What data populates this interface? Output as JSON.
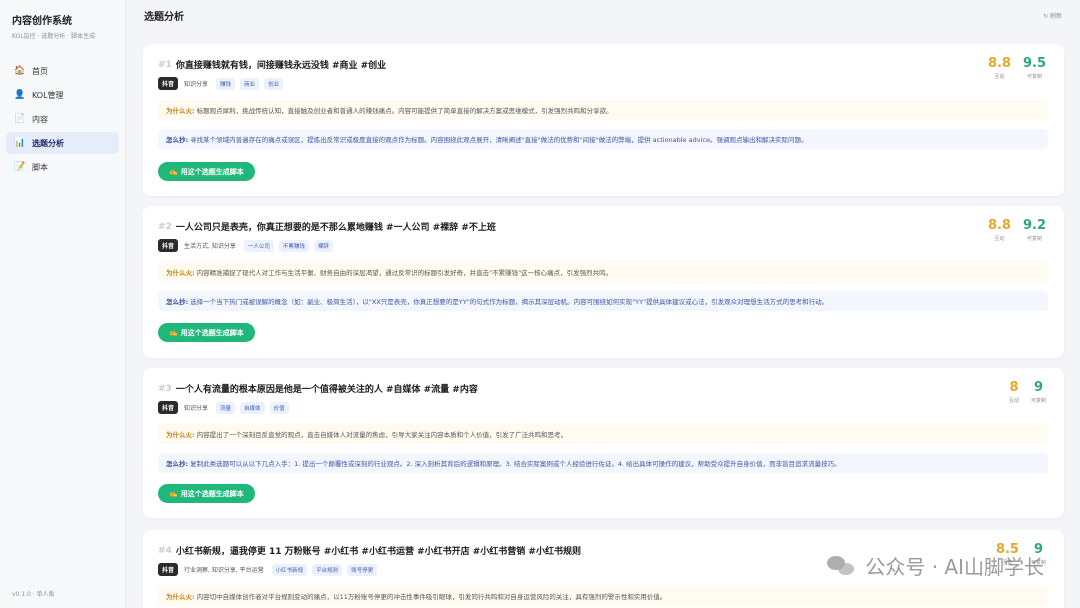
{
  "app": {
    "title": "内容创作系统",
    "subtitle": "KOL监控 · 选题分析 · 脚本生成",
    "version": "v0.1.0 · 单人版"
  },
  "nav": [
    {
      "label": "首页",
      "icon": "home-icon",
      "glyph": "🏠"
    },
    {
      "label": "KOL管理",
      "icon": "user-icon",
      "glyph": "👤"
    },
    {
      "label": "内容",
      "icon": "document-icon",
      "glyph": "📄"
    },
    {
      "label": "选题分析",
      "icon": "chart-icon",
      "glyph": "📊",
      "active": true
    },
    {
      "label": "脚本",
      "icon": "note-icon",
      "glyph": "📝"
    }
  ],
  "header": {
    "title": "选题分析",
    "refresh_label": "↻ 刷新"
  },
  "labels": {
    "why": "为什么火:",
    "how": "怎么抄:",
    "score_a": "互动",
    "score_b": "可复制",
    "generate": "用这个选题生成脚本"
  },
  "topics": [
    {
      "num": "#1",
      "title": "你直接赚钱就有钱，间接赚钱永远没钱 #商业 #创业",
      "platform": "抖音",
      "category": "知识分享",
      "tags": [
        "赚钱",
        "商业",
        "创业"
      ],
      "score_a": "8.8",
      "score_b": "9.5",
      "why": "标题观点犀利，挑战传统认知，直接触及创业者和普通人的赚钱痛点。内容可能提供了简单直接的解决方案或思维模式，引发强烈共鸣和分享欲。",
      "how": "寻找某个领域内普遍存在的痛点或误区，提炼出反常识或极度直接的观点作为标题。内容围绕此观点展开，清晰阐述\"直接\"做法的优势和\"间接\"做法的弊端，提供 actionable advice。强调观点输出和解决实际问题。"
    },
    {
      "num": "#2",
      "title": "一人公司只是表壳，你真正想要的是不那么累地赚钱 #一人公司 #裸辞 #不上班",
      "platform": "抖音",
      "category": "生活方式, 知识分享",
      "tags": [
        "一人公司",
        "不累赚钱",
        "裸辞"
      ],
      "score_a": "8.8",
      "score_b": "9.2",
      "why": "内容精准捕捉了现代人对工作与生活平衡、财务自由的深层渴望，通过反常识的标题引发好奇，并直击\"不累赚钱\"这一核心痛点，引发强烈共鸣。",
      "how": "选择一个当下热门或被误解的概念（如：副业、极简生活），以\"XX只是表壳，你真正想要的是YY\"的句式作为标题，揭示其深层动机。内容可围绕如何实现\"YY\"提供具体建议或心法，引发观众对理想生活方式的思考和行动。"
    },
    {
      "num": "#3",
      "title": "一个人有流量的根本原因是他是一个值得被关注的人 #自媒体 #流量 #内容",
      "platform": "抖音",
      "category": "知识分享",
      "tags": [
        "流量",
        "自媒体",
        "价值"
      ],
      "score_a": "8",
      "score_b": "9",
      "why": "内容提出了一个深刻且反直觉的观点，直击自媒体人对流量的焦虑，引导大家关注内容本质和个人价值，引发了广泛共鸣和思考。",
      "how": "复制此类选题可以从以下几点入手：1. 提出一个颠覆性或深刻的行业观点。2. 深入剖析其背后的逻辑和原理。3. 结合实际案例或个人经验进行佐证。4. 给出具体可操作的建议，帮助受众提升自身价值，而非盲目追求流量技巧。"
    },
    {
      "num": "#4",
      "title": "小红书新规，逼我停更 11 万粉账号 #小红书 #小红书运营 #小红书开店 #小红书营销 #小红书规则",
      "platform": "抖音",
      "category": "行业洞察, 知识分享, 平台运营",
      "tags": [
        "小红书新规",
        "平台规则",
        "账号停更"
      ],
      "score_a": "8.5",
      "score_b": "9",
      "why": "内容切中自媒体创作者对平台规则变动的痛点，以11万粉账号停更的冲击性事件吸引眼球，引发同行共鸣和对自身运营风险的关注，具有强烈的警示性和实用价值。"
    }
  ],
  "watermark": {
    "text": "公众号 · AI山脚学长",
    "icon": "wechat-icon"
  }
}
